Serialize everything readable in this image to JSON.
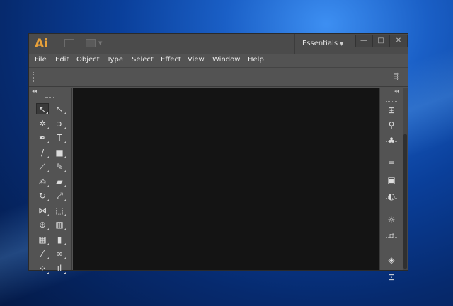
{
  "app": {
    "logo": "Ai",
    "workspace": "Essentials",
    "window_controls": [
      "minimize",
      "maximize",
      "close"
    ]
  },
  "menu": [
    "File",
    "Edit",
    "Object",
    "Type",
    "Select",
    "Effect",
    "View",
    "Window",
    "Help"
  ],
  "tools_panel": {
    "collapse_icon": "◂◂",
    "tools": [
      {
        "name": "selection-tool-icon",
        "glyph": "↖",
        "selected": true
      },
      {
        "name": "direct-selection-tool-icon",
        "glyph": "↖"
      },
      {
        "name": "magic-wand-tool-icon",
        "glyph": "✲"
      },
      {
        "name": "lasso-tool-icon",
        "glyph": "ↄ"
      },
      {
        "name": "pen-tool-icon",
        "glyph": "✒"
      },
      {
        "name": "type-tool-icon",
        "glyph": "T"
      },
      {
        "name": "line-segment-tool-icon",
        "glyph": "/"
      },
      {
        "name": "rectangle-tool-icon",
        "glyph": "■"
      },
      {
        "name": "paintbrush-tool-icon",
        "glyph": "⟋"
      },
      {
        "name": "pencil-tool-icon",
        "glyph": "✎"
      },
      {
        "name": "blob-brush-tool-icon",
        "glyph": "✍"
      },
      {
        "name": "eraser-tool-icon",
        "glyph": "▰"
      },
      {
        "name": "rotate-tool-icon",
        "glyph": "↻"
      },
      {
        "name": "scale-tool-icon",
        "glyph": "⤢"
      },
      {
        "name": "width-tool-icon",
        "glyph": "⋈"
      },
      {
        "name": "free-transform-tool-icon",
        "glyph": "⬚"
      },
      {
        "name": "shape-builder-tool-icon",
        "glyph": "⊕"
      },
      {
        "name": "chart-tool-icon",
        "glyph": "▥"
      },
      {
        "name": "mesh-tool-icon",
        "glyph": "▦"
      },
      {
        "name": "gradient-tool-icon",
        "glyph": "▮"
      },
      {
        "name": "eyedropper-tool-icon",
        "glyph": "⁄"
      },
      {
        "name": "blend-tool-icon",
        "glyph": "∞"
      },
      {
        "name": "symbol-sprayer-tool-icon",
        "glyph": "⁘"
      },
      {
        "name": "column-graph-tool-icon",
        "glyph": "ıl"
      }
    ]
  },
  "right_panel": {
    "collapse_icon": "◂◂",
    "icons": [
      {
        "name": "swatches-icon",
        "glyph": "⊞"
      },
      {
        "name": "brushes-icon",
        "glyph": "⚲"
      },
      {
        "name": "symbols-icon",
        "glyph": "♣"
      },
      {
        "name": "stroke-icon",
        "glyph": "≡"
      },
      {
        "name": "gradient-icon",
        "glyph": "▣"
      },
      {
        "name": "transparency-icon",
        "glyph": "◐"
      },
      {
        "name": "appearance-icon",
        "glyph": "☼"
      },
      {
        "name": "graphic-styles-icon",
        "glyph": "⧉"
      },
      {
        "name": "layers-icon",
        "glyph": "◈"
      },
      {
        "name": "artboards-icon",
        "glyph": "⊡"
      }
    ]
  },
  "colors": {
    "logo": "#e8a13a",
    "chrome": "#535353",
    "canvas": "#141414"
  }
}
